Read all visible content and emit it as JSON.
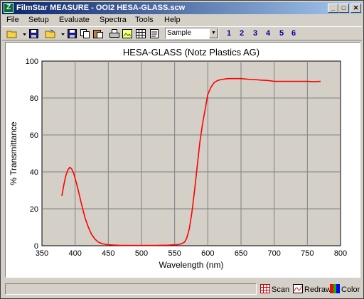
{
  "window": {
    "title": "FilmStar MEASURE - OOI2 HESA-GLASS.scw",
    "icon_letter": "Z",
    "minimize": "_",
    "maximize": "□",
    "close": "✕"
  },
  "menu": [
    {
      "label": "File"
    },
    {
      "label": "Setup"
    },
    {
      "label": "Evaluate"
    },
    {
      "label": "Spectra"
    },
    {
      "label": "Tools"
    },
    {
      "label": "Help"
    }
  ],
  "toolbar": {
    "icons": [
      "open-folder-icon",
      "save-disk-icon",
      "open-folder-icon",
      "save-disk-icon",
      "copy-icon",
      "paste-icon",
      "print-icon",
      "image-icon",
      "grid-icon",
      "notes-icon"
    ],
    "sample_select": "Sample",
    "numbers": [
      "1",
      "2",
      "3",
      "4",
      "5",
      "6"
    ]
  },
  "status": {
    "scan": "Scan",
    "redraw": "Redraw",
    "color": "Color"
  },
  "chart_data": {
    "type": "line",
    "title": "HESA-GLASS (Notz Plastics AG)",
    "xlabel": "Wavelength (nm)",
    "ylabel": "% Transmittance",
    "xlim": [
      350,
      800
    ],
    "ylim": [
      0,
      100
    ],
    "xticks": [
      350,
      400,
      450,
      500,
      550,
      600,
      650,
      700,
      750,
      800
    ],
    "yticks": [
      0,
      20,
      40,
      60,
      80,
      100
    ],
    "grid": true,
    "series": [
      {
        "color": "#ff0000",
        "x": [
          380,
          383,
          386,
          389,
          392,
          395,
          398,
          402,
          406,
          410,
          415,
          420,
          425,
          430,
          435,
          440,
          445,
          450,
          460,
          470,
          480,
          500,
          520,
          540,
          555,
          560,
          565,
          568,
          572,
          576,
          580,
          584,
          588,
          592,
          596,
          600,
          605,
          610,
          615,
          620,
          630,
          640,
          650,
          660,
          670,
          680,
          690,
          700,
          710,
          720,
          730,
          740,
          750,
          760,
          770
        ],
        "y": [
          27,
          33,
          38,
          41,
          42.5,
          41.5,
          39,
          34,
          28,
          22,
          15,
          10,
          6,
          3.5,
          2,
          1.2,
          0.8,
          0.5,
          0.3,
          0.2,
          0.2,
          0.2,
          0.2,
          0.3,
          0.6,
          1,
          2,
          4,
          9,
          18,
          30,
          43,
          56,
          66,
          74,
          82,
          86,
          88.5,
          89.5,
          90,
          90.5,
          90.5,
          90.5,
          90.2,
          90,
          89.7,
          89.5,
          89,
          89,
          89,
          89,
          89,
          89,
          88.8,
          89
        ]
      }
    ]
  }
}
